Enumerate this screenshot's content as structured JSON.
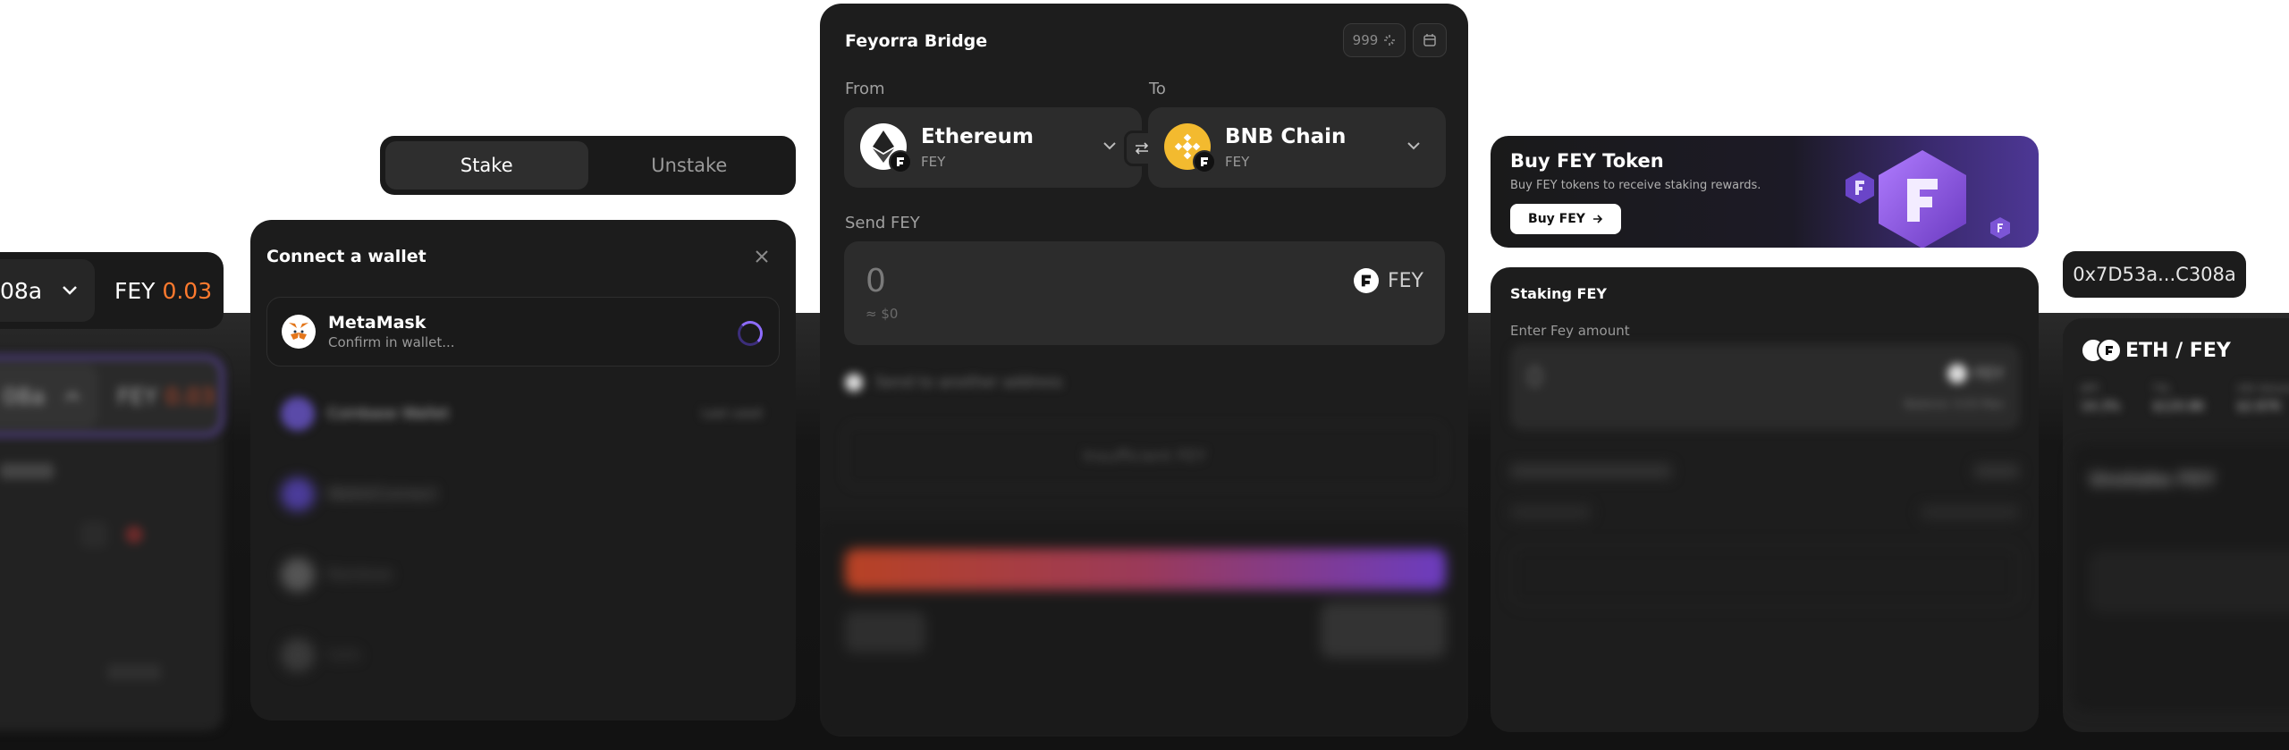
{
  "left_chip": {
    "address": "08a",
    "token_label": "FEY",
    "token_value": "0.03"
  },
  "left_panel": {
    "address": "08a",
    "token_label": "FEY",
    "token_value": "0.03"
  },
  "stake_toggle": {
    "stake": "Stake",
    "unstake": "Unstake"
  },
  "connect_wallet": {
    "title": "Connect a wallet",
    "wallets": [
      {
        "name": "MetaMask",
        "status": "Confirm in wallet..."
      },
      {
        "name": "Coinbase Wallet",
        "status": "Last used"
      },
      {
        "name": "WalletConnect",
        "status": ""
      },
      {
        "name": "Rainbow",
        "status": ""
      },
      {
        "name": "Safe",
        "status": ""
      }
    ]
  },
  "bridge": {
    "title": "Feyorra Bridge",
    "counter": "999",
    "from_label": "From",
    "to_label": "To",
    "from_chain": {
      "name": "Ethereum",
      "token": "FEY"
    },
    "to_chain": {
      "name": "BNB Chain",
      "token": "FEY"
    },
    "send_label": "Send FEY",
    "send_amount": "0",
    "send_usd": "≈ $0",
    "send_token": "FEY",
    "send_to_other": "Send to another address",
    "submit_label": "Insufficient FEY"
  },
  "buy_banner": {
    "title": "Buy FEY Token",
    "subtitle": "Buy FEY tokens to receive staking rewards.",
    "button": "Buy FEY"
  },
  "staking": {
    "title": "Staking FEY",
    "input_label": "Enter Fey amount",
    "amount": "0",
    "token": "FEY",
    "balance": "Balance: 0.03 Max"
  },
  "address_pill": "0x7D53a...C308a",
  "pool": {
    "title": "ETH / FEY",
    "stats": [
      {
        "label": "APY",
        "value": "14.3%"
      },
      {
        "label": "TVL",
        "value": "$120.8K"
      },
      {
        "label": "24h Volume",
        "value": "$2.87K"
      }
    ],
    "section": "Unstake FEY"
  },
  "colors": {
    "accent_orange": "#ff7a2e",
    "accent_purple": "#8e6cff",
    "bnb_yellow": "#f3ba2f",
    "card_bg": "#1d1d1d"
  }
}
